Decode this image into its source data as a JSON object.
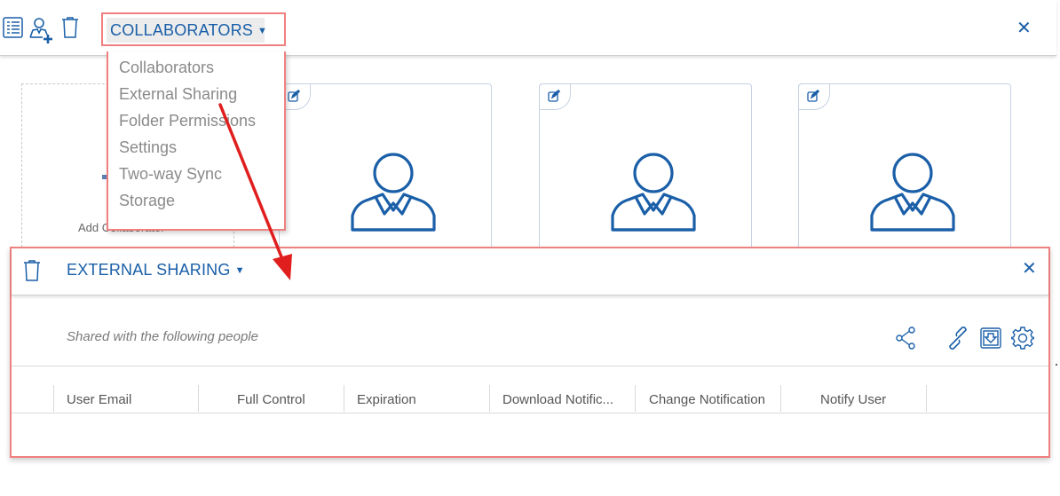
{
  "colors": {
    "accent": "#1a5fa8",
    "highlight_border": "#f08080",
    "arrow": "#e01e1e",
    "menu_text": "#8a8a8a"
  },
  "toolbar": {
    "icons": [
      "list-icon",
      "add-user-icon",
      "trash-icon"
    ],
    "dropdown_label": "COLLABORATORS",
    "close_symbol": "✕"
  },
  "menu": {
    "items": [
      {
        "label": "Collaborators"
      },
      {
        "label": "External Sharing"
      },
      {
        "label": "Folder Permissions"
      },
      {
        "label": "Settings"
      },
      {
        "label": "Two-way Sync"
      },
      {
        "label": "Storage"
      }
    ]
  },
  "cards": {
    "add_label": "Add Collaborator",
    "collaborators": [
      {
        "icon": "user-icon"
      },
      {
        "icon": "user-icon"
      },
      {
        "icon": "user-icon"
      }
    ]
  },
  "external_sharing": {
    "title": "EXTERNAL SHARING",
    "close_symbol": "✕",
    "subtitle": "Shared with the following people",
    "action_icons": [
      "share-icon",
      "link-icon",
      "download-icon",
      "settings-gear-icon"
    ],
    "columns": [
      {
        "label": "User Email"
      },
      {
        "label": "Full Control"
      },
      {
        "label": "Expiration"
      },
      {
        "label": "Download Notific..."
      },
      {
        "label": "Change Notification"
      },
      {
        "label": "Notify User"
      }
    ]
  }
}
